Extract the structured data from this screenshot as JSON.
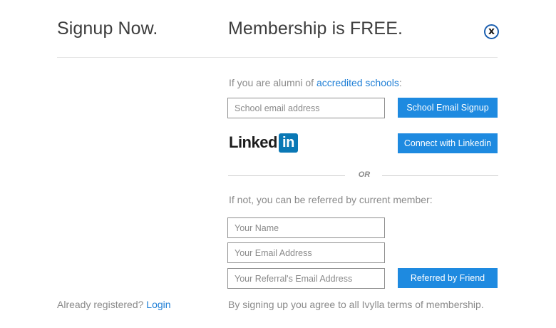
{
  "header": {
    "title_left": "Signup Now.",
    "title_right": "Membership is FREE.",
    "close_label": "x"
  },
  "alumni": {
    "prefix": "If you are alumni of",
    "link_text": "accredited schools",
    "suffix": ":",
    "school_email_placeholder": "School email address",
    "school_email_button": "School Email Signup"
  },
  "linkedin": {
    "logo_text": "Linked",
    "logo_box": "in",
    "connect_button": "Connect with Linkedin"
  },
  "divider": {
    "or_text": "OR"
  },
  "referral": {
    "intro": "If not, you can be referred by current member:",
    "name_placeholder": "Your Name",
    "email_placeholder": "Your Email Address",
    "referral_email_placeholder": "Your Referral's Email Address",
    "submit_button": "Referred by Friend"
  },
  "footer": {
    "registered_prefix": "Already registered?",
    "login_link": "Login",
    "terms": "By signing up you agree to all Ivylla terms of membership."
  },
  "colors": {
    "accent": "#1e8ae0",
    "link": "#1f7fd6",
    "linkedin_blue": "#0a78b5"
  }
}
